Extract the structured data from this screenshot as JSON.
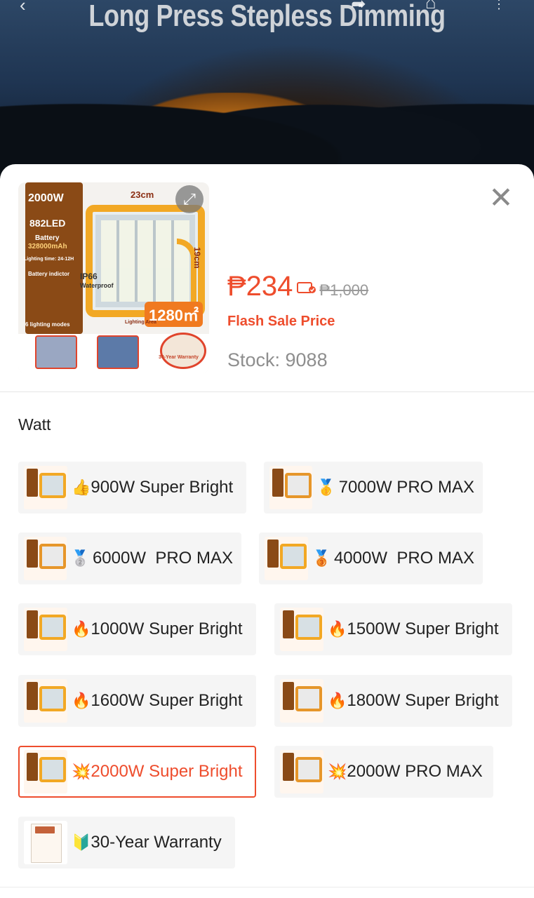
{
  "hero": {
    "title": "Long Press Stepless Dimming",
    "icons": [
      "back-icon",
      "share-icon",
      "cart-icon",
      "more-icon"
    ]
  },
  "product": {
    "price": "₱234",
    "original_price": "₱1,000",
    "price_label": "Flash Sale Price",
    "stock": "Stock: 9088",
    "thumb": {
      "watt": "2000W",
      "led": "882LED",
      "battery_title": "Battery",
      "battery": "328000mAh",
      "lighting_time": "Lighting time: 24-12H",
      "battery_indicator": "Battery indictor",
      "modes": "6 lighting modes",
      "width": "23cm",
      "height": "19cm",
      "ip": "IP66",
      "waterproof": "Waterproof",
      "area": "1280㎡",
      "area_label": "Lighting Area",
      "warranty": "30-Year Warranty"
    }
  },
  "variation": {
    "title": "Watt",
    "options": [
      {
        "emoji": "👍",
        "label": "900W Super Bright",
        "selected": false
      },
      {
        "emoji": "🥇",
        "label": "7000W PRO MAX",
        "selected": false
      },
      {
        "emoji": "🥈",
        "label": "6000W  PRO MAX",
        "selected": false
      },
      {
        "emoji": "🥉",
        "label": "4000W  PRO MAX",
        "selected": false
      },
      {
        "emoji": "🔥",
        "label": "1000W Super Bright",
        "selected": false
      },
      {
        "emoji": "🔥",
        "label": "1500W Super Bright",
        "selected": false
      },
      {
        "emoji": "🔥",
        "label": "1600W Super Bright",
        "selected": false
      },
      {
        "emoji": "🔥",
        "label": "1800W Super Bright",
        "selected": false
      },
      {
        "emoji": "💥",
        "label": "2000W Super Bright",
        "selected": true
      },
      {
        "emoji": "💥",
        "label": "2000W PRO MAX",
        "selected": false
      },
      {
        "emoji": "🔰",
        "label": "30-Year Warranty",
        "selected": false
      }
    ]
  },
  "colors": {
    "accent": "#ee4d2d",
    "option_bg": "#f5f5f5",
    "muted": "#8e8e8e"
  }
}
